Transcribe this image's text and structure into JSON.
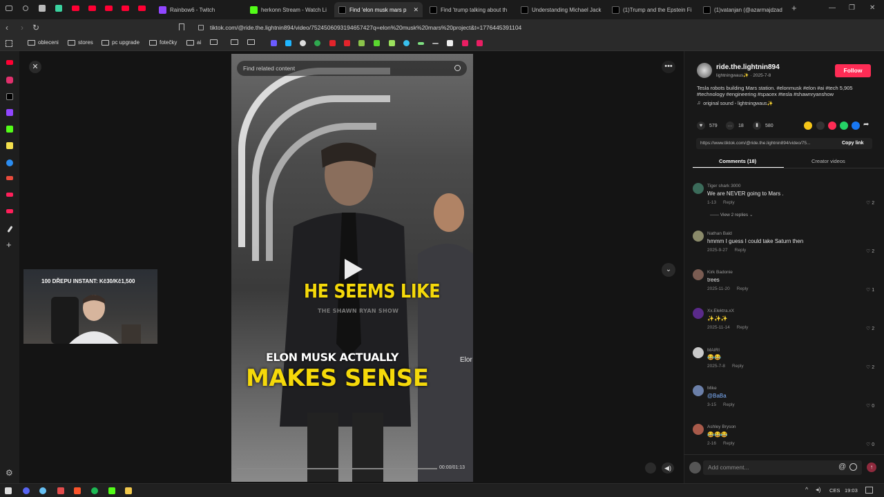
{
  "tabs": [
    {
      "label": "Rainbow6 - Twitch",
      "color": "#9146ff"
    },
    {
      "label": "herkonn Stream - Watch Li",
      "color": "#53fc18"
    },
    {
      "label": "Find 'elon musk mars p",
      "color": "#ffffff",
      "active": true
    },
    {
      "label": "Find 'trump talking about th",
      "color": "#ffffff"
    },
    {
      "label": "Understanding Michael Jack",
      "color": "#ffffff"
    },
    {
      "label": "(1)Trump and the Epstein Fi",
      "color": "#ffffff"
    },
    {
      "label": "(1)vatanjan (@azarmajdzad",
      "color": "#ffffff"
    }
  ],
  "address": {
    "url": "tiktok.com/@ride.the.lightnin894/video/7524506093194657427q=elon%20musk%20mars%20project&t=1776445391104"
  },
  "bookmarks": {
    "items": [
      "obleceni",
      "stores",
      "pc upgrade",
      "fotečky",
      "ai"
    ]
  },
  "video": {
    "search_placeholder": "Find related content",
    "caption_top": "HE SEEMS LIKE",
    "caption_sub": "THE SHAWN RYAN SHOW",
    "caption_line1": "ELON MUSK ACTUALLY",
    "caption_line2": "MAKES SENSE",
    "side_text": "Elor",
    "timecode": "00:00/01:13"
  },
  "webcam": {
    "overlay_text": "100 DŘEPU INSTANT: Kč30/Kč1,500"
  },
  "panel": {
    "author": "ride.the.lightnin894",
    "author_sub": "lightningwaus✨ · 2025-7-8",
    "follow_label": "Follow",
    "description": "Tesla robots building Mars station. #elonmusk #elon #ai #tech 5,905",
    "description2": "#technology #engineering #spacex #tesla #shawnryanshow",
    "sound": "original sound - lightningwaus✨",
    "likes": "579",
    "comments_count": "18",
    "bookmarks": "580",
    "link": "https://www.tiktok.com/@ride.the.lightnin894/video/75...",
    "copy_link_label": "Copy link",
    "tab_comments": "Comments (18)",
    "tab_creator": "Creator videos",
    "add_comment_placeholder": "Add comment..."
  },
  "comments": [
    {
      "name": "Tiger shark 3000",
      "text": "We are NEVER going to Mars .",
      "date": "1-13",
      "reply": "Reply",
      "likes": "2",
      "extra": "View 2 replies"
    },
    {
      "name": "Nathan Bald",
      "text": "hmmm I guess I could take Saturn then",
      "date": "2025-9-27",
      "reply": "Reply",
      "likes": "2"
    },
    {
      "name": "Kirk Badonie",
      "text": "trees",
      "date": "2025-11-20",
      "reply": "Reply",
      "likes": "1"
    },
    {
      "name": "Xx.Elektra.xX",
      "text": "✨✨✨",
      "date": "2025-11-14",
      "reply": "Reply",
      "likes": "2"
    },
    {
      "name": "MAIRI",
      "text": "😂😂",
      "date": "2025-7-8",
      "reply": "Reply",
      "likes": "2"
    },
    {
      "name": "Mike",
      "text": "@BaBa",
      "date": "3-15",
      "reply": "Reply",
      "likes": "0"
    },
    {
      "name": "Ashley Bryson",
      "text": "😂😂😂",
      "date": "2-16",
      "reply": "Reply",
      "likes": "0"
    }
  ],
  "taskbar": {
    "lang": "CES",
    "time": "19:03"
  },
  "colors": {
    "accent": "#fe2c55",
    "caption_yellow": "#f5d90a"
  }
}
